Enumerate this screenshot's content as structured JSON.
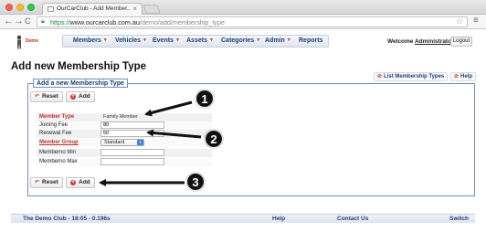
{
  "browser": {
    "tab_title": "OurCarClub - Add Member...",
    "tab_close": "×",
    "url_scheme": "https://",
    "url_host": "www.ourcarclub.com.au",
    "url_path": "/demo/add/membership_type",
    "back_icon": "←",
    "forward_icon": "→",
    "reload_icon": "C",
    "star_icon": "☆",
    "menu_icon": "≡"
  },
  "header": {
    "logo_text": "Demo",
    "nav": [
      {
        "label": "Members",
        "caret": "▼"
      },
      {
        "label": "Vehicles",
        "caret": "▼"
      },
      {
        "label": "Events",
        "caret": "▼"
      },
      {
        "label": "Assets",
        "caret": "▼"
      },
      {
        "label": "Categories",
        "caret": "▼"
      },
      {
        "label": "Admin",
        "caret": "▼"
      },
      {
        "label": "Reports",
        "caret": ""
      }
    ],
    "welcome_prefix": "Welcome ",
    "welcome_user": "Administrator",
    "logout_label": "Logout"
  },
  "page": {
    "title": "Add new Membership Type",
    "list_link": "List Membership Types",
    "help_link": "Help",
    "legend": "Add a new Membership Type"
  },
  "buttons": {
    "reset": "Reset",
    "add": "Add",
    "reset_icon": "↶",
    "add_icon": "+"
  },
  "form": {
    "member_type_label": "Member Type",
    "member_type_value": "Family Member",
    "joining_fee_label": "Joining Fee",
    "joining_fee_value": "80",
    "renewal_fee_label": "Renewal Fee",
    "renewal_fee_value": "50",
    "member_group_label": "Member Group",
    "member_group_value": "Standard",
    "memberno_min_label": "Memberno Min",
    "memberno_max_label": "Memberno Max"
  },
  "callouts": [
    "1",
    "2",
    "3"
  ],
  "footer": {
    "club": "The Demo Club - 18:05 - 0.196s",
    "help": "Help",
    "contact": "Contact Us",
    "switch": "Switch"
  },
  "colors": {
    "nav_text": "#1f3e77",
    "required_label": "#c0302a",
    "accent_red": "#d13a2f",
    "fieldset_border": "#6d8fc4"
  }
}
